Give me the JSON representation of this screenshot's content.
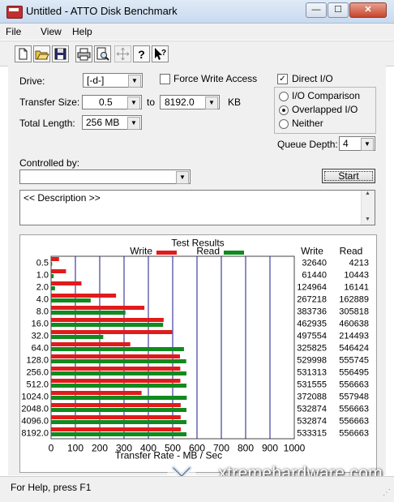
{
  "window": {
    "title": "Untitled - ATTO Disk Benchmark",
    "min_glyph": "—",
    "max_glyph": "☐",
    "close_glyph": "✕"
  },
  "menu": [
    "File",
    "View",
    "Help"
  ],
  "toolbar": [
    "new-icon",
    "open-icon",
    "save-icon",
    "print-icon",
    "print-preview-icon",
    "move-icon",
    "help-icon",
    "context-help-icon"
  ],
  "drive": {
    "label": "Drive:",
    "value": "[-d-]"
  },
  "force_write": {
    "label": "Force Write Access",
    "checked": false
  },
  "direct_io": {
    "label": "Direct I/O",
    "checked": true
  },
  "transfer_size": {
    "label": "Transfer Size:",
    "from": "0.5",
    "to_label": "to",
    "to": "8192.0",
    "unit": "KB"
  },
  "total_length": {
    "label": "Total Length:",
    "value": "256 MB"
  },
  "io_mode": {
    "options": [
      "I/O Comparison",
      "Overlapped I/O",
      "Neither"
    ],
    "selected": 1
  },
  "queue_depth": {
    "label": "Queue Depth:",
    "value": "4"
  },
  "controlled_by": {
    "label": "Controlled by:",
    "value": ""
  },
  "start_label": "Start",
  "description": "<< Description >>",
  "chart_data": {
    "type": "bar",
    "title": "Test Results",
    "xlabel": "Transfer Rate - MB / Sec",
    "xlim": [
      0,
      1000
    ],
    "xticks": [
      0,
      100,
      200,
      300,
      400,
      500,
      600,
      700,
      800,
      900,
      1000
    ],
    "grid": true,
    "legend": "top-center",
    "categories": [
      "0.5",
      "1.0",
      "2.0",
      "4.0",
      "8.0",
      "16.0",
      "32.0",
      "64.0",
      "128.0",
      "256.0",
      "512.0",
      "1024.0",
      "2048.0",
      "4096.0",
      "8192.0"
    ],
    "series": [
      {
        "name": "Write",
        "color": "#e11b1b",
        "values": [
          32640,
          61440,
          124964,
          267218,
          383736,
          462935,
          497554,
          325825,
          529998,
          531313,
          531555,
          372088,
          532874,
          532874,
          533315
        ]
      },
      {
        "name": "Read",
        "color": "#118a1f",
        "values": [
          4213,
          10443,
          16141,
          162889,
          305818,
          460638,
          214493,
          546424,
          555745,
          556495,
          556663,
          557948,
          556663,
          556663,
          556663
        ]
      }
    ],
    "table_headers": [
      "Write",
      "Read"
    ]
  },
  "status_text": "For Help, press F1",
  "watermark": "xtremehardware.com"
}
